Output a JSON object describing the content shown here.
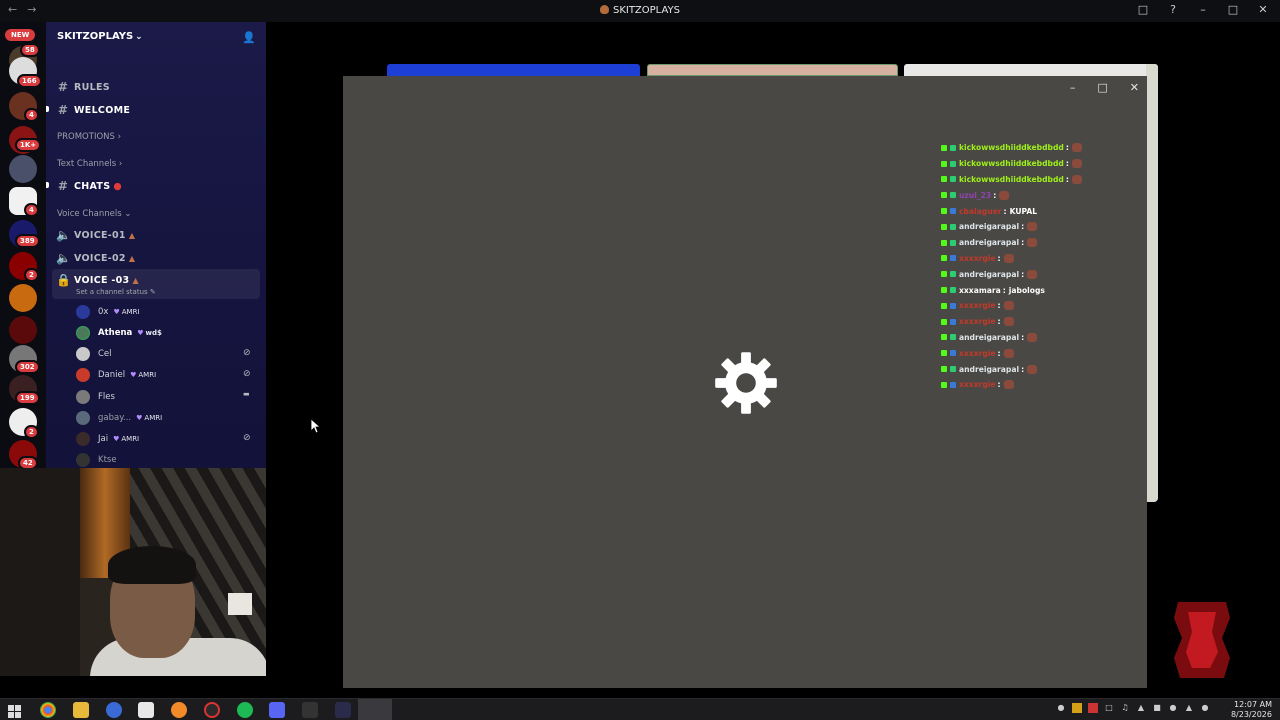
{
  "window": {
    "title": "SKITZOPLAYS",
    "controls": [
      "minimize",
      "maximize",
      "close"
    ]
  },
  "rail": {
    "new_label": "NEW",
    "badges": [
      "58",
      "166",
      "4",
      "1K+",
      "4",
      "389",
      "2",
      "302",
      "199",
      "2",
      "42"
    ]
  },
  "server": {
    "name": "SKITZOPLAYS",
    "channels": {
      "rules": "RULES",
      "welcome": "WELCOME",
      "promotions": "PROMOTIONS",
      "text_category": "Text Channels",
      "chats": "CHATS",
      "voice_category": "Voice Channels",
      "voice_01": "VOICE-01",
      "voice_02": "VOICE-02",
      "voice_03": "VOICE -03",
      "voice_03_status": "Set a channel status"
    },
    "members": [
      {
        "name": "0x",
        "tag": "AMRI"
      },
      {
        "name": "Athena",
        "tag": "wd$"
      },
      {
        "name": "Cel",
        "tag": ""
      },
      {
        "name": "Daniel",
        "tag": "AMRI"
      },
      {
        "name": "Fles",
        "tag": ""
      },
      {
        "name": "gabay...",
        "tag": "AMRI"
      },
      {
        "name": "Jai",
        "tag": "AMRI"
      },
      {
        "name": "Ktse",
        "tag": ""
      }
    ]
  },
  "chat": [
    {
      "user": "kickowwsdhiiddkebdbdd",
      "color": "#9ef01a",
      "text": ""
    },
    {
      "user": "kickowwsdhiiddkebdbdd",
      "color": "#9ef01a",
      "text": ""
    },
    {
      "user": "kickowwsdhiiddkebdbdd",
      "color": "#9ef01a",
      "text": ""
    },
    {
      "user": "uzul_23",
      "color": "#8e44ad",
      "text": ""
    },
    {
      "user": "cbalaguer",
      "color": "#c0392b",
      "text": "KUPAL"
    },
    {
      "user": "andreigarapal",
      "color": "#dfe6e9",
      "text": ""
    },
    {
      "user": "andreigarapal",
      "color": "#dfe6e9",
      "text": ""
    },
    {
      "user": "xxxxrgie",
      "color": "#c0392b",
      "text": ""
    },
    {
      "user": "andreigarapal",
      "color": "#dfe6e9",
      "text": ""
    },
    {
      "user": "xxxamara",
      "color": "#ffffff",
      "text": "jabologs"
    },
    {
      "user": "xxxxrgie",
      "color": "#c0392b",
      "text": ""
    },
    {
      "user": "xxxxrgie",
      "color": "#c0392b",
      "text": ""
    },
    {
      "user": "andreigarapal",
      "color": "#dfe6e9",
      "text": ""
    },
    {
      "user": "xxxxrgie",
      "color": "#c0392b",
      "text": ""
    },
    {
      "user": "andreigarapal",
      "color": "#dfe6e9",
      "text": ""
    },
    {
      "user": "xxxxrgie",
      "color": "#c0392b",
      "text": ""
    }
  ],
  "clock": {
    "time": "12:07 AM",
    "date": "8/23/2026"
  },
  "colors": {
    "sidebar": "#1b1a48",
    "player_bg": "#4a4845",
    "accent_red": "#d83c3e"
  }
}
